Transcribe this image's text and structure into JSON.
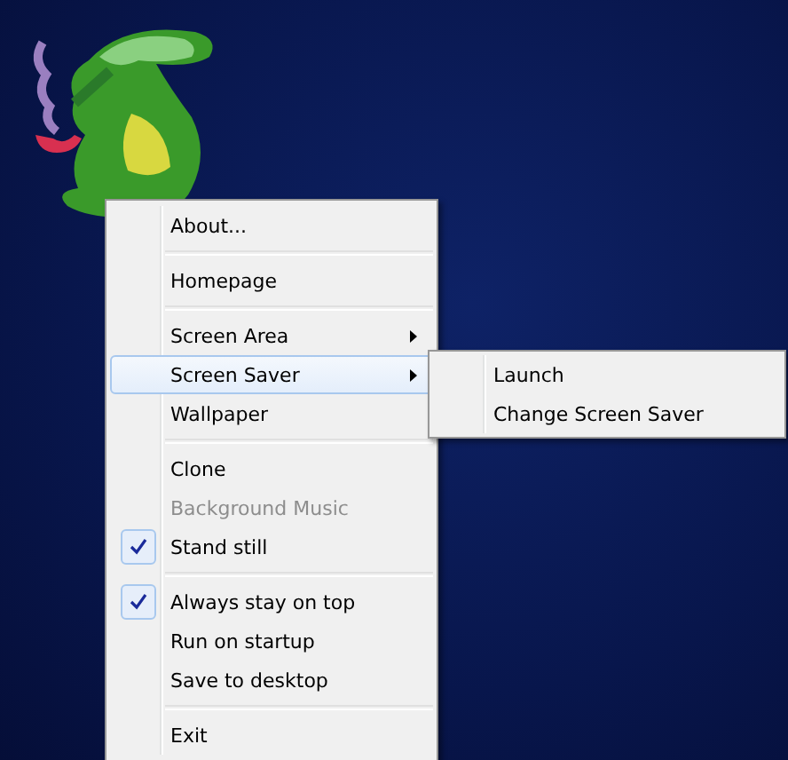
{
  "menu": {
    "items": [
      {
        "kind": "item",
        "label": "About...",
        "checked": false,
        "disabled": false,
        "has_submenu": false,
        "selected": false
      },
      {
        "kind": "separator"
      },
      {
        "kind": "item",
        "label": "Homepage",
        "checked": false,
        "disabled": false,
        "has_submenu": false,
        "selected": false
      },
      {
        "kind": "separator"
      },
      {
        "kind": "item",
        "label": "Screen Area",
        "checked": false,
        "disabled": false,
        "has_submenu": true,
        "selected": false
      },
      {
        "kind": "item",
        "label": "Screen Saver",
        "checked": false,
        "disabled": false,
        "has_submenu": true,
        "selected": true,
        "submenu": [
          {
            "label": "Launch"
          },
          {
            "label": "Change Screen Saver"
          }
        ]
      },
      {
        "kind": "item",
        "label": "Wallpaper",
        "checked": false,
        "disabled": false,
        "has_submenu": false,
        "selected": false
      },
      {
        "kind": "separator"
      },
      {
        "kind": "item",
        "label": "Clone",
        "checked": false,
        "disabled": false,
        "has_submenu": false,
        "selected": false
      },
      {
        "kind": "item",
        "label": "Background Music",
        "checked": false,
        "disabled": true,
        "has_submenu": false,
        "selected": false
      },
      {
        "kind": "item",
        "label": "Stand still",
        "checked": true,
        "disabled": false,
        "has_submenu": false,
        "selected": false
      },
      {
        "kind": "separator"
      },
      {
        "kind": "item",
        "label": "Always stay on top",
        "checked": true,
        "disabled": false,
        "has_submenu": false,
        "selected": false
      },
      {
        "kind": "item",
        "label": "Run on startup",
        "checked": false,
        "disabled": false,
        "has_submenu": false,
        "selected": false
      },
      {
        "kind": "item",
        "label": "Save to desktop",
        "checked": false,
        "disabled": false,
        "has_submenu": false,
        "selected": false
      },
      {
        "kind": "separator"
      },
      {
        "kind": "item",
        "label": "Exit",
        "checked": false,
        "disabled": false,
        "has_submenu": false,
        "selected": false
      }
    ]
  }
}
